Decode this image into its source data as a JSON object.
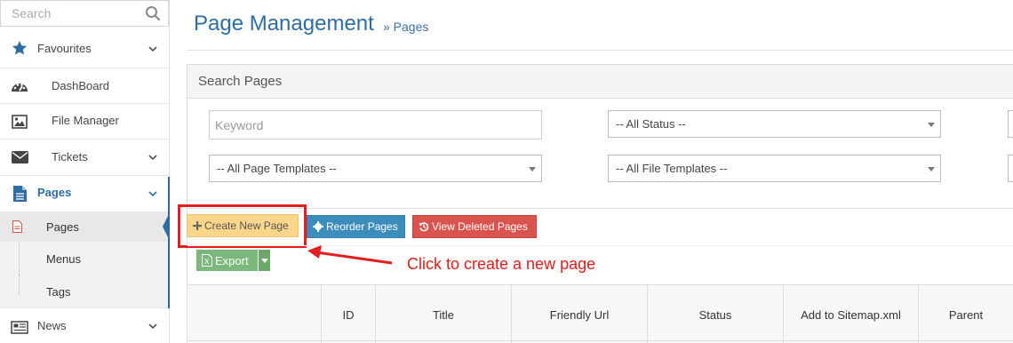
{
  "sidebar": {
    "search_placeholder": "Search",
    "items": [
      {
        "label": "Favourites",
        "icon": "star-icon"
      },
      {
        "label": "DashBoard",
        "icon": "dashboard-icon"
      },
      {
        "label": "File Manager",
        "icon": "image-icon"
      },
      {
        "label": "Tickets",
        "icon": "envelope-icon"
      },
      {
        "label": "Pages",
        "icon": "document-icon"
      },
      {
        "label": "News",
        "icon": "newspaper-icon"
      }
    ],
    "sub_items": [
      {
        "label": "Pages",
        "icon": "document-small-icon"
      },
      {
        "label": "Menus"
      },
      {
        "label": "Tags"
      }
    ],
    "accent_color": "#2e6da4"
  },
  "header": {
    "title": "Page Management",
    "breadcrumb": "» Pages"
  },
  "search_panel": {
    "title": "Search Pages",
    "keyword_placeholder": "Keyword",
    "status_select": "-- All Status --",
    "page_templates_select": "-- All Page Templates --",
    "file_templates_select": "-- All File Templates --"
  },
  "toolbar": {
    "create_label": "Create New Page",
    "reorder_label": "Reorder Pages",
    "deleted_label": "View Deleted Pages",
    "export_label": "Export"
  },
  "annotation": {
    "text": "Click to create a new page",
    "color": "#e41e1e"
  },
  "table": {
    "columns": [
      "",
      "ID",
      "Title",
      "Friendly Url",
      "Status",
      "Add to Sitemap.xml",
      "Parent"
    ]
  }
}
